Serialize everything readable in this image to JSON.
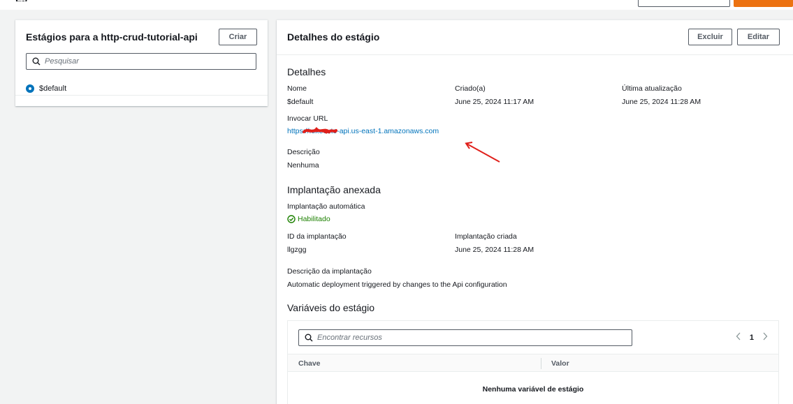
{
  "top": {
    "title_fragment": "Es"
  },
  "left_panel": {
    "title": "Estágios para a http-crud-tutorial-api",
    "create_button": "Criar",
    "search_placeholder": "Pesquisar",
    "stages": [
      {
        "name": "$default",
        "selected": true
      }
    ]
  },
  "right_panel": {
    "title": "Detalhes do estágio",
    "delete_button": "Excluir",
    "edit_button": "Editar",
    "details": {
      "title": "Detalhes",
      "name_label": "Nome",
      "name_value": "$default",
      "created_label": "Criado(a)",
      "created_value": "June 25, 2024 11:17 AM",
      "updated_label": "Última atualização",
      "updated_value": "June 25, 2024 11:28 AM",
      "invoke_url_label": "Invocar URL",
      "invoke_url_value": "https://.execute-api.us-east-1.amazonaws.com",
      "description_label": "Descrição",
      "description_value": "Nenhuma"
    },
    "deployment": {
      "title": "Implantação anexada",
      "auto_label": "Implantação automática",
      "auto_value": "Habilitado",
      "id_label": "ID da implantação",
      "id_value": "llgzgg",
      "created_label": "Implantação criada",
      "created_value": "June 25, 2024 11:28 AM",
      "description_label": "Descrição da implantação",
      "description_value": "Automatic deployment triggered by changes to the Api configuration"
    },
    "variables": {
      "title": "Variáveis do estágio",
      "search_placeholder": "Encontrar recursos",
      "page": "1",
      "columns": [
        "Chave",
        "Valor"
      ],
      "empty_message": "Nenhuma variável de estágio"
    }
  },
  "colors": {
    "link": "#0073bb",
    "success": "#1d8102",
    "primary": "#ec7211",
    "annotation": "#e0201b"
  },
  "icons": [
    "search-icon",
    "radio-selected-icon",
    "check-circle-icon",
    "chevron-left-icon",
    "chevron-right-icon",
    "arrow-annotation"
  ]
}
